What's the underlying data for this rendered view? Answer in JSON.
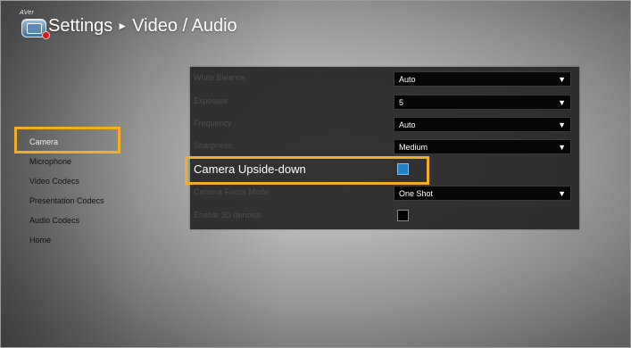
{
  "header": {
    "brand": "AVer",
    "breadcrumb_root": "Settings",
    "breadcrumb_separator": "►",
    "breadcrumb_current": "Video / Audio"
  },
  "icons": {
    "logo": "aver-vc-logo-icon",
    "dropdown_arrow": "triangle-down-icon"
  },
  "sidebar": {
    "items": [
      {
        "label": "Camera",
        "selected": true
      },
      {
        "label": "Microphone",
        "selected": false
      },
      {
        "label": "Video Codecs",
        "selected": false
      },
      {
        "label": "Presentation Codecs",
        "selected": false
      },
      {
        "label": "Audio Codecs",
        "selected": false
      },
      {
        "label": "Home",
        "selected": false
      }
    ]
  },
  "settings": {
    "white_balance": {
      "label": "White Balance",
      "value": "Auto"
    },
    "exposure": {
      "label": "Exposure",
      "value": "5"
    },
    "frequency": {
      "label": "Frequency",
      "value": "Auto"
    },
    "sharpness": {
      "label": "Sharpness",
      "value": "Medium"
    },
    "camera_upside_down": {
      "label": "Camera Upside-down",
      "checked": true
    },
    "camera_focus_mode": {
      "label": "Camera Focus Mode",
      "value": "One Shot"
    },
    "enable_3d_denoise": {
      "label": "Enable 3D denoise",
      "checked": false
    }
  },
  "dropdown_arrow_glyph": "▼",
  "colors": {
    "highlight": "#f2ad24",
    "checkbox_checked": "#2381c9",
    "panel_background": "#222222"
  }
}
